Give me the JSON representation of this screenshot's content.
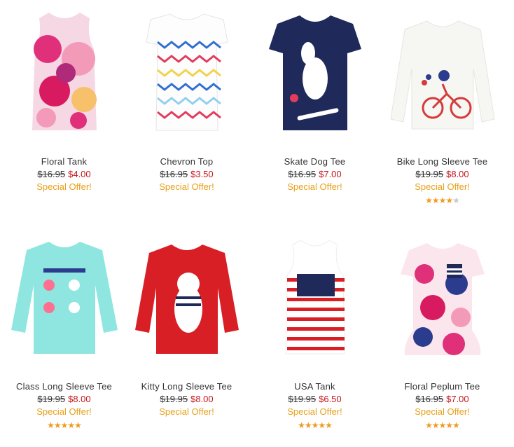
{
  "products": [
    {
      "name": "Floral Tank",
      "old_price": "$16.95",
      "new_price": "$4.00",
      "offer": "Special Offer!",
      "rating": 0,
      "image": "floral-tank-image",
      "colors": {
        "primary": "#e0307a",
        "secondary": "#f39ab8",
        "accent": "#f7c06a"
      }
    },
    {
      "name": "Chevron Top",
      "old_price": "$16.95",
      "new_price": "$3.50",
      "offer": "Special Offer!",
      "rating": 0,
      "image": "chevron-top-image",
      "colors": {
        "primary": "#2f6fd1",
        "secondary": "#e23b5b",
        "accent": "#f2d24a"
      }
    },
    {
      "name": "Skate Dog Tee",
      "old_price": "$16.95",
      "new_price": "$7.00",
      "offer": "Special Offer!",
      "rating": 0,
      "image": "skate-dog-tee-image",
      "colors": {
        "primary": "#1f2a5a",
        "secondary": "#ffffff",
        "accent": "#e23b5b"
      }
    },
    {
      "name": "Bike Long Sleeve Tee",
      "old_price": "$19.95",
      "new_price": "$8.00",
      "offer": "Special Offer!",
      "rating": 4.5,
      "image": "bike-long-sleeve-tee-image",
      "colors": {
        "primary": "#f6f6f3",
        "secondary": "#d63a3a",
        "accent": "#2b3c8f"
      }
    },
    {
      "name": "Class Long Sleeve Tee",
      "old_price": "$19.95",
      "new_price": "$8.00",
      "offer": "Special Offer!",
      "rating": 5,
      "image": "class-long-sleeve-tee-image",
      "colors": {
        "primary": "#8fe6e0",
        "secondary": "#ff6f8f",
        "accent": "#2b3c8f"
      }
    },
    {
      "name": "Kitty Long Sleeve Tee",
      "old_price": "$19.95",
      "new_price": "$8.00",
      "offer": "Special Offer!",
      "rating": 0,
      "image": "kitty-long-sleeve-tee-image",
      "colors": {
        "primary": "#d91f26",
        "secondary": "#ffffff",
        "accent": "#1f2a5a"
      }
    },
    {
      "name": "USA Tank",
      "old_price": "$19.95",
      "new_price": "$6.50",
      "offer": "Special Offer!",
      "rating": 5,
      "image": "usa-tank-image",
      "colors": {
        "primary": "#d91f26",
        "secondary": "#ffffff",
        "accent": "#1f2a5a"
      }
    },
    {
      "name": "Floral Peplum Tee",
      "old_price": "$16.95",
      "new_price": "$7.00",
      "offer": "Special Offer!",
      "rating": 5,
      "image": "floral-peplum-tee-image",
      "colors": {
        "primary": "#e0307a",
        "secondary": "#2b3c8f",
        "accent": "#ffffff"
      }
    }
  ]
}
